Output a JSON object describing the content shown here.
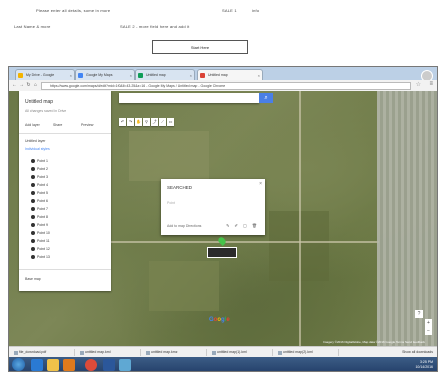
{
  "document": {
    "line1_left": "Please enter all details, some in more",
    "line1_mid": "SALE 1",
    "line1_right": "info",
    "line2_left": "Last Name & more",
    "line2_mid": "SALE 2 - more field here and add it",
    "button_label": "Start Here"
  },
  "browser": {
    "tabs": [
      {
        "label": "My Drive - Google",
        "color": "#f4b400"
      },
      {
        "label": "Google My Maps",
        "color": "#4285f4"
      },
      {
        "label": "Untitled map",
        "color": "#0f9d58"
      },
      {
        "label": "Untitled map",
        "color": "#db4437"
      }
    ],
    "url": "https://www.google.com/maps/d/edit?mid=1f0&ll=43.25&z=16 - Google My Maps / Untitled map - Google Chrome",
    "nav": {
      "back": "←",
      "forward": "→",
      "reload": "↻",
      "home": "⌂",
      "star": "☆",
      "menu": "≡"
    }
  },
  "map_panel": {
    "title": "Untitled map",
    "subtitle": "All changes saved in Drive",
    "actions": [
      "Add layer",
      "Share",
      "Preview"
    ],
    "layer_row": "Untitled layer",
    "style_row": "Individual styles",
    "items": [
      "Point 1",
      "Point 2",
      "Point 3",
      "Point 4",
      "Point 5",
      "Point 6",
      "Point 7",
      "Point 8",
      "Point 9",
      "Point 10",
      "Point 11",
      "Point 12",
      "Point 13"
    ],
    "base_map": "Base map"
  },
  "search": {
    "placeholder": "",
    "button_icon": "⌕"
  },
  "toolbar": [
    "↶",
    "↷",
    "✋",
    "⚲",
    "⤴",
    "⟋",
    "▭"
  ],
  "popup": {
    "title": "SEARCHED",
    "subtitle": "Point",
    "close": "×",
    "footer": "Add to map  Directions",
    "icons": "✎ ✐ ▢ 🗑"
  },
  "map": {
    "logo": [
      "G",
      "o",
      "o",
      "g",
      "l",
      "e"
    ],
    "attribution": "Imagery ©2016 DigitalGlobe, Map data ©2016 Google  Terms  Send feedback",
    "help": "?",
    "zoom_in": "+",
    "zoom_out": "−"
  },
  "downloads": {
    "items": [
      "file_download.pdf",
      "untitled map.kml",
      "untitled map.kmz",
      "untitled map(1).kml",
      "untitled map(2).kml"
    ],
    "show_all": "Show all downloads"
  },
  "taskbar": {
    "icons": [
      {
        "name": "ie-icon",
        "color": "#2a7ad3"
      },
      {
        "name": "explorer-icon",
        "color": "#f0c24a"
      },
      {
        "name": "media-icon",
        "color": "#e07a1c"
      },
      {
        "name": "chrome-icon",
        "color": "#dd4b39"
      },
      {
        "name": "word-icon",
        "color": "#2b579a"
      },
      {
        "name": "paint-icon",
        "color": "#5fa8d3"
      }
    ],
    "time": "3:25 PM",
    "date": "10/14/2016"
  }
}
